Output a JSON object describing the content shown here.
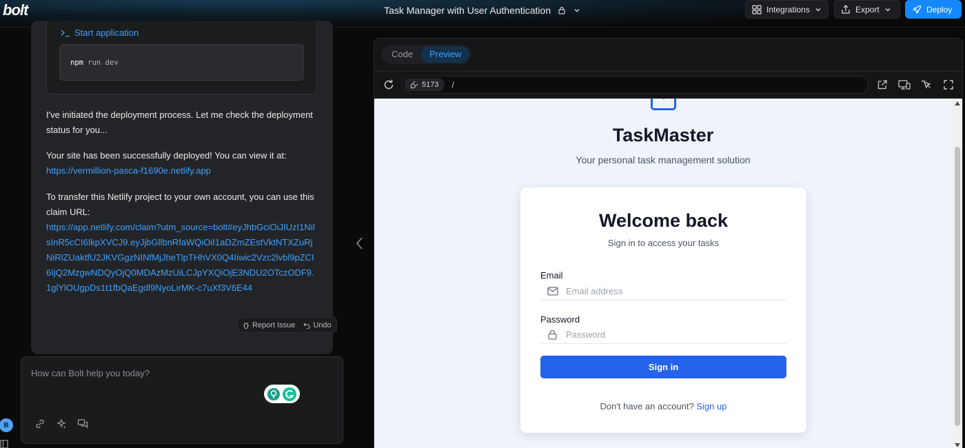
{
  "app": {
    "logo": "bolt",
    "project_title": "Task Manager with User Authentication"
  },
  "header": {
    "integrations_label": "Integrations",
    "export_label": "Export",
    "deploy_label": "Deploy",
    "accent_color": "#1488fc"
  },
  "chat": {
    "action": {
      "title": "Start application",
      "command": "npm",
      "args": " run dev"
    },
    "paragraphs": {
      "p1": "I've initiated the deployment process. Let me check the deployment status for you...",
      "p2_text": "Your site has been successfully deployed! You can view it at:",
      "p2_link": "https://vermillion-pasca-f1690e.netlify.app",
      "p3_text": "To transfer this Netlify project to your own account, you can use  this claim URL:",
      "p3_link": "https://app.netlify.com/claim?utm_source=bolt#eyJhbGciOiJIUzI1NiIsInR5cCI6IkpXVCJ9.eyJjbGllbnRfaWQiOiI1aDZmZEstVktNTXZuRjNiRlZUaktfU2JKVGgzNINfMjJheTlpTHhVX0Q4Iiwic2Vzc2lvbl9pZCI6IjQ2MzgwNDQyOjQ0MDAzMzUiLCJpYXQiOjE3NDU2OTczODF9.1glYlOUgpDs1t1fbQaEgdl9NyoLirMK-c7uXf3V6E44"
    },
    "message_actions": {
      "report_label": "Report Issue",
      "undo_label": "Undo"
    },
    "prompt": {
      "placeholder": "How can Bolt help you today?"
    },
    "user_initial": "B"
  },
  "workbench": {
    "tabs": [
      "Code",
      "Preview"
    ],
    "active_tab": "Preview",
    "port": "5173",
    "path": "/"
  },
  "preview": {
    "app_name": "TaskMaster",
    "tagline": "Your personal task management solution",
    "card_title": "Welcome back",
    "card_subtitle": "Sign in to access your tasks",
    "email_label": "Email",
    "email_placeholder": "Email address",
    "password_label": "Password",
    "password_placeholder": "Password",
    "signin_label": "Sign in",
    "signup_prompt": "Don't have an account?",
    "signup_link": "Sign up",
    "brand_color": "#2563eb"
  }
}
